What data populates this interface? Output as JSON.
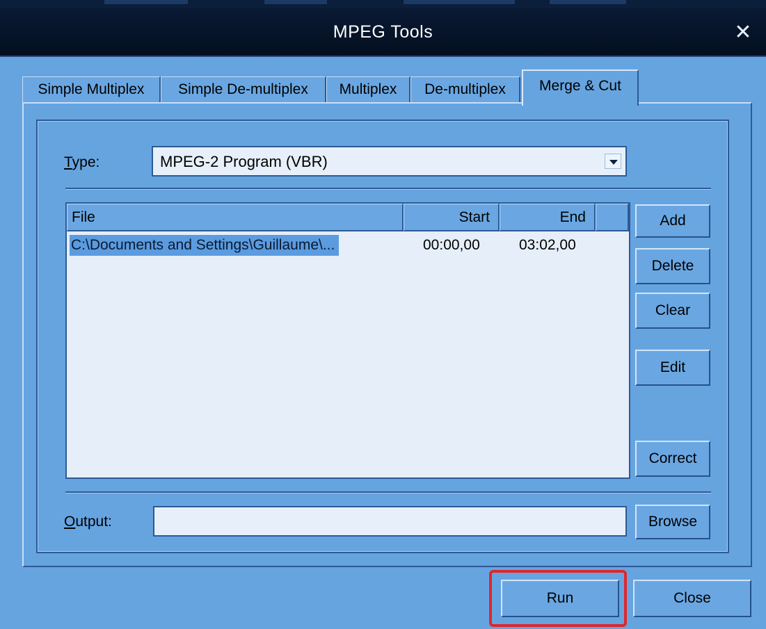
{
  "window": {
    "title": "MPEG Tools"
  },
  "tabs": [
    {
      "label": "Simple Multiplex"
    },
    {
      "label": "Simple De-multiplex"
    },
    {
      "label": "Multiplex"
    },
    {
      "label": "De-multiplex"
    },
    {
      "label": "Merge & Cut",
      "active": true
    }
  ],
  "type_field": {
    "label_accel": "T",
    "label_rest": "ype:",
    "value": "MPEG-2 Program (VBR)"
  },
  "file_list": {
    "columns": {
      "file": "File",
      "start": "Start",
      "end": "End"
    },
    "rows": [
      {
        "file": "C:\\Documents and Settings\\Guillaume\\...",
        "start": "00:00,00",
        "end": "03:02,00",
        "selected": true
      }
    ]
  },
  "side_buttons": {
    "add": "Add",
    "delete": "Delete",
    "clear": "Clear",
    "edit": "Edit",
    "correct": "Correct"
  },
  "output_field": {
    "label_accel": "O",
    "label_rest": "utput:",
    "value": "",
    "browse": "Browse"
  },
  "footer": {
    "run": "Run",
    "close": "Close"
  },
  "colors": {
    "window_bg": "#66a4e0",
    "titlebar": "#07152b",
    "selection": "#5b9be0",
    "highlight_box": "#e0262c"
  },
  "icons": {
    "close": "close-x-icon",
    "dropdown": "chevron-down-icon"
  }
}
